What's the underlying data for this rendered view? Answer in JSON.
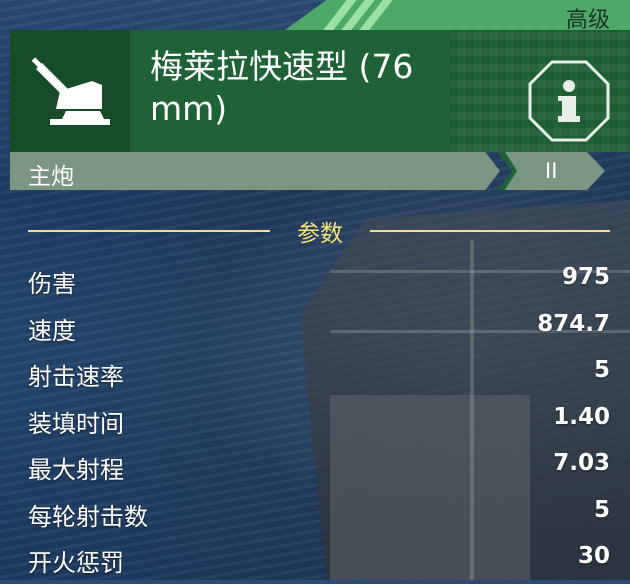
{
  "header": {
    "tier_label": "高级",
    "weapon_name": "梅莱拉快速型 (76 mm)",
    "icon": "deck-gun-icon",
    "info_icon": "info-icon"
  },
  "type_bar": {
    "label": "主炮",
    "tier": "II"
  },
  "section": {
    "title": "参数"
  },
  "stats": [
    {
      "label": "伤害",
      "value": "975"
    },
    {
      "label": "速度",
      "value": "874.7"
    },
    {
      "label": "射击速率",
      "value": "5"
    },
    {
      "label": "装填时间",
      "value": "1.40"
    },
    {
      "label": "最大射程",
      "value": "7.03"
    },
    {
      "label": "每轮射击数",
      "value": "5"
    },
    {
      "label": "开火惩罚",
      "value": "30"
    }
  ],
  "colors": {
    "header_green": "#1f6235",
    "ribbon_green": "#4ea86a",
    "type_bar": "#7a9682",
    "section_accent": "#f0e28a"
  }
}
